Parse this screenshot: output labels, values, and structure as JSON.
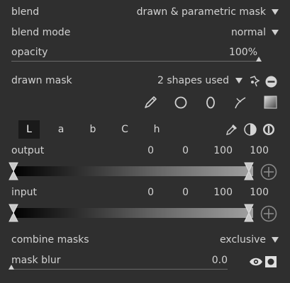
{
  "blend": {
    "label": "blend",
    "value": "drawn & parametric mask"
  },
  "blend_mode": {
    "label": "blend mode",
    "value": "normal"
  },
  "opacity": {
    "label": "opacity",
    "value": "100%",
    "level": 1.0
  },
  "drawn_mask": {
    "label": "drawn mask",
    "value": "2 shapes used"
  },
  "tabs": [
    {
      "label": "L",
      "active": true
    },
    {
      "label": "a"
    },
    {
      "label": "b"
    },
    {
      "label": "C"
    },
    {
      "label": "h"
    }
  ],
  "output": {
    "label": "output",
    "values": [
      "0",
      "0",
      "100",
      "100"
    ]
  },
  "input": {
    "label": "input",
    "values": [
      "0",
      "0",
      "100",
      "100"
    ]
  },
  "combine_masks": {
    "label": "combine masks",
    "value": "exclusive"
  },
  "mask_blur": {
    "label": "mask blur",
    "value": "0.0",
    "level": 0.0
  },
  "colors": {
    "background": "#2f2f2f",
    "text": "#d2d2d2",
    "active_tab": "#1a1a1a"
  }
}
